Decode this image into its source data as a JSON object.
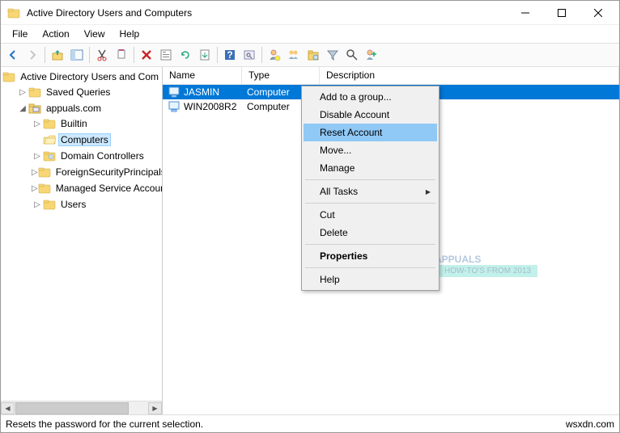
{
  "window": {
    "title": "Active Directory Users and Computers"
  },
  "menubar": [
    "File",
    "Action",
    "View",
    "Help"
  ],
  "tree": {
    "root_label": "Active Directory Users and Com",
    "saved_queries": "Saved Queries",
    "domain": "appuals.com",
    "nodes": {
      "builtin": "Builtin",
      "computers": "Computers",
      "domain_controllers": "Domain Controllers",
      "fsp": "ForeignSecurityPrincipals",
      "msa": "Managed Service Accoun",
      "users": "Users"
    }
  },
  "list": {
    "columns": {
      "name": "Name",
      "type": "Type",
      "desc": "Description"
    },
    "rows": [
      {
        "name": "JASMIN",
        "type": "Computer",
        "desc": ""
      },
      {
        "name": "WIN2008R2",
        "type": "Computer",
        "desc": ""
      }
    ]
  },
  "context_menu": {
    "add_group": "Add to a group...",
    "disable": "Disable Account",
    "reset": "Reset Account",
    "move": "Move...",
    "manage": "Manage",
    "all_tasks": "All Tasks",
    "cut": "Cut",
    "delete": "Delete",
    "properties": "Properties",
    "help": "Help"
  },
  "statusbar": {
    "text": "Resets the password for the current selection.",
    "credit": "wsxdn.com"
  },
  "watermark": {
    "brand": "APPUALS",
    "badge": "HOW-TO'S FROM 2013"
  }
}
